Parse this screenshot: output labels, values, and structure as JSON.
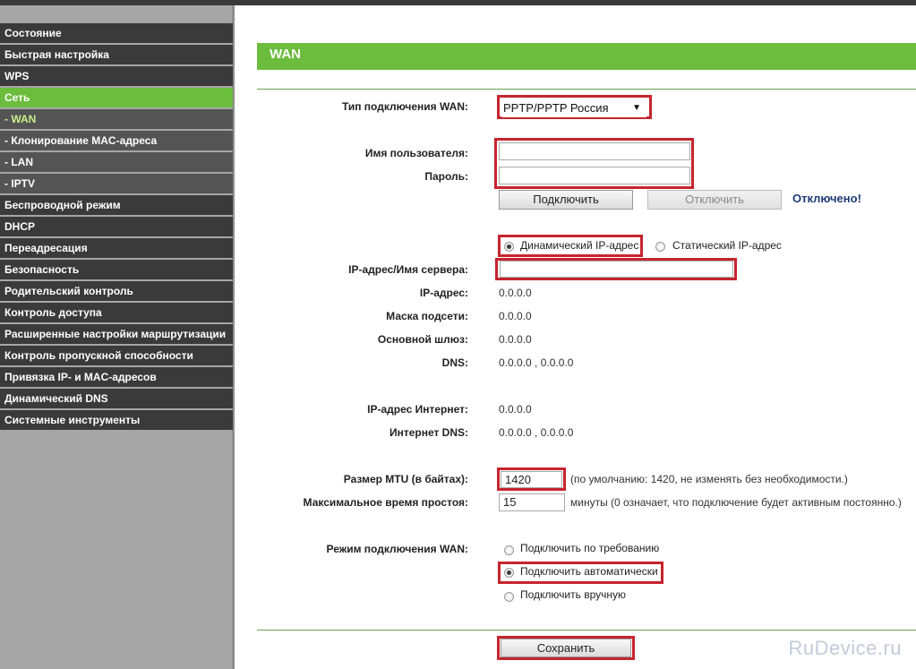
{
  "sidebar": {
    "items": [
      {
        "label": "Состояние"
      },
      {
        "label": "Быстрая настройка"
      },
      {
        "label": "WPS"
      },
      {
        "label": "Сеть"
      },
      {
        "label": "- WAN"
      },
      {
        "label": "- Клонирование MAC-адреса"
      },
      {
        "label": "- LAN"
      },
      {
        "label": "- IPTV"
      },
      {
        "label": "Беспроводной режим"
      },
      {
        "label": "DHCP"
      },
      {
        "label": "Переадресация"
      },
      {
        "label": "Безопасность"
      },
      {
        "label": "Родительский контроль"
      },
      {
        "label": "Контроль доступа"
      },
      {
        "label": "Расширенные настройки маршрутизации"
      },
      {
        "label": "Контроль пропускной способности"
      },
      {
        "label": "Привязка IP- и MAC-адресов"
      },
      {
        "label": "Динамический DNS"
      },
      {
        "label": "Системные инструменты"
      }
    ]
  },
  "page": {
    "title": "WAN"
  },
  "form": {
    "wan_type_label": "Тип подключения WAN:",
    "wan_type_value": "PPTP/PPTP Россия",
    "username_label": "Имя пользователя:",
    "username_value": "",
    "password_label": "Пароль:",
    "password_value": "",
    "connect_button": "Подключить",
    "disconnect_button": "Отключить",
    "status": "Отключено!",
    "ip_mode_dynamic": "Динамический IP-адрес",
    "ip_mode_static": "Статический IP-адрес",
    "server_label": "IP-адрес/Имя сервера:",
    "server_value": "",
    "ip_label": "IP-адрес:",
    "ip_value": "0.0.0.0",
    "mask_label": "Маска подсети:",
    "mask_value": "0.0.0.0",
    "gateway_label": "Основной шлюз:",
    "gateway_value": "0.0.0.0",
    "dns_label": "DNS:",
    "dns_value": "0.0.0.0 , 0.0.0.0",
    "inet_ip_label": "IP-адрес Интернет:",
    "inet_ip_value": "0.0.0.0",
    "inet_dns_label": "Интернет DNS:",
    "inet_dns_value": "0.0.0.0 , 0.0.0.0",
    "mtu_label": "Размер MTU (в байтах):",
    "mtu_value": "1420",
    "mtu_note": "(по умолчанию: 1420, не изменять без необходимости.)",
    "idle_label": "Максимальное время простоя:",
    "idle_value": "15",
    "idle_note": "минуты (0 означает, что подключение будет активным постоянно.)",
    "mode_label": "Режим подключения WAN:",
    "mode_on_demand": "Подключить по требованию",
    "mode_auto": "Подключить автоматически",
    "mode_manual": "Подключить вручную",
    "save_button": "Сохранить"
  },
  "watermark": "RuDevice.ru",
  "colors": {
    "accent": "#6cbc3e",
    "highlight": "#c6242e",
    "nav": "#3a3a3a"
  }
}
